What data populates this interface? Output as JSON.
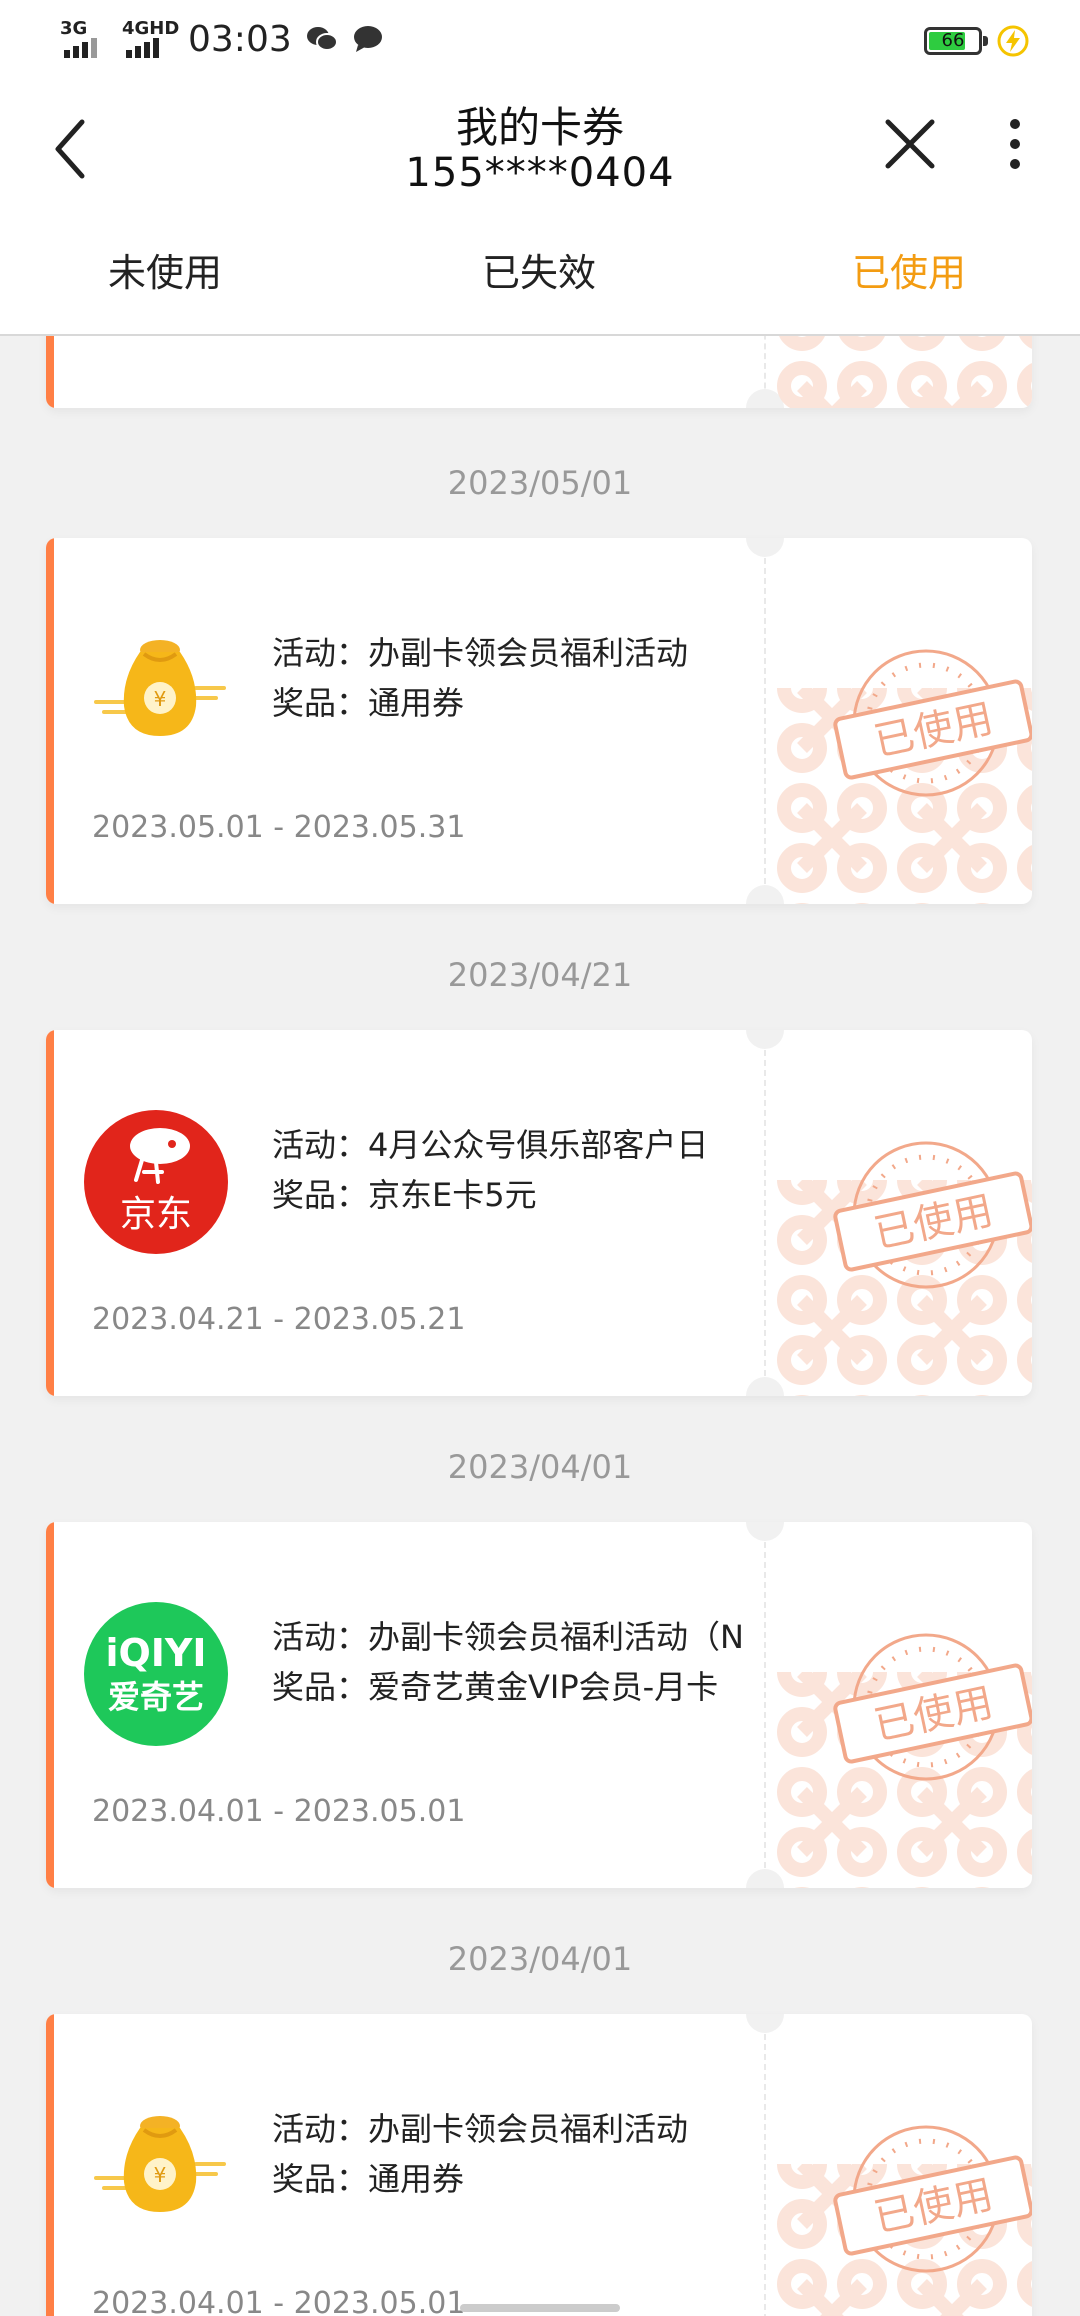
{
  "status_bar": {
    "net1": "3G",
    "net2": "4GHD",
    "time": "03:03",
    "battery": "66"
  },
  "header": {
    "title": "我的卡券",
    "subtitle": "155****0404"
  },
  "tabs": [
    {
      "label": "未使用"
    },
    {
      "label": "已失效"
    },
    {
      "label": "已使用"
    }
  ],
  "colors": {
    "accent": "#ff7f45",
    "tab_active": "#f39c12",
    "stamp": "#f2a88a"
  },
  "coupons": [
    {
      "date": "2023/05/01",
      "activity": "活动：办副卡领会员福利活动",
      "prize": "奖品：通用券",
      "range": "2023.05.01 - 2023.05.31",
      "logo_icon": "money-bag-icon",
      "stamp": "已使用"
    },
    {
      "date": "2023/04/21",
      "activity": "活动：4月公众号俱乐部客户日",
      "prize": "奖品：京东E卡5元",
      "range": "2023.04.21 - 2023.05.21",
      "logo_icon": "jd-logo-icon",
      "logo_text": "京东",
      "stamp": "已使用"
    },
    {
      "date": "2023/04/01",
      "activity": "活动：办副卡领会员福利活动（N",
      "prize": "奖品：爱奇艺黄金VIP会员-月卡",
      "range": "2023.04.01 - 2023.05.01",
      "logo_icon": "iqiyi-logo-icon",
      "logo_text_top": "iQIYI",
      "logo_text_bottom": "爱奇艺",
      "stamp": "已使用"
    },
    {
      "date": "2023/04/01",
      "activity": "活动：办副卡领会员福利活动",
      "prize": "奖品：通用券",
      "range": "2023.04.01 - 2023.05.01",
      "logo_icon": "money-bag-icon",
      "stamp": "已使用"
    }
  ]
}
